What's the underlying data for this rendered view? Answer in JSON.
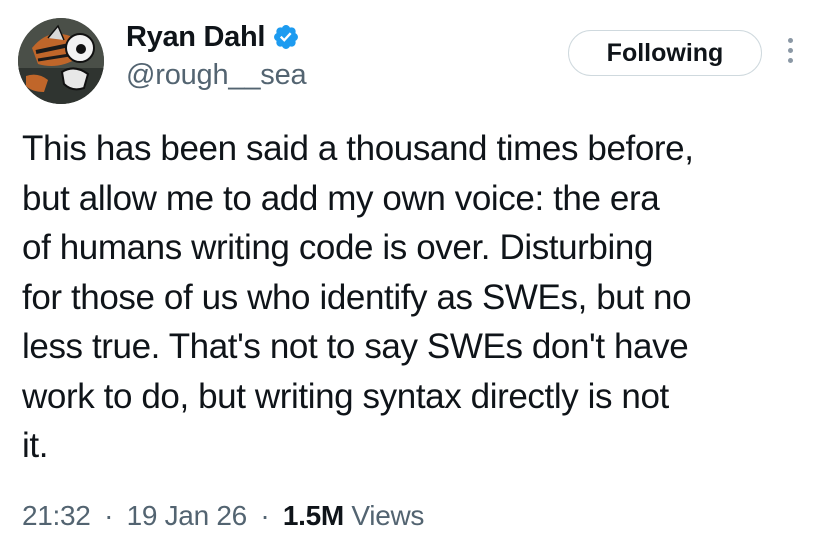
{
  "author": {
    "display_name": "Ryan Dahl",
    "handle": "@rough__sea",
    "verified": true,
    "avatar_icon": "cartoon-avatar"
  },
  "actions": {
    "follow_label": "Following",
    "more_icon": "vertical-dots-icon"
  },
  "tweet": {
    "lines": [
      "This has been said a thousand times before,",
      "but allow me to add my own voice: the era",
      "of humans writing code is over. Disturbing",
      "for those of us who identify as SWEs, but no",
      "less true. That's not to say SWEs don't have",
      "work to do, but writing syntax directly is not",
      "it."
    ]
  },
  "meta": {
    "time": "21:32",
    "date": "19 Jan 26",
    "views_count": "1.5M",
    "views_label": "Views",
    "separator": "·"
  },
  "colors": {
    "text": "#0f1419",
    "secondary": "#536471",
    "verified_blue": "#1d9bf0",
    "border": "#cfd9de"
  }
}
